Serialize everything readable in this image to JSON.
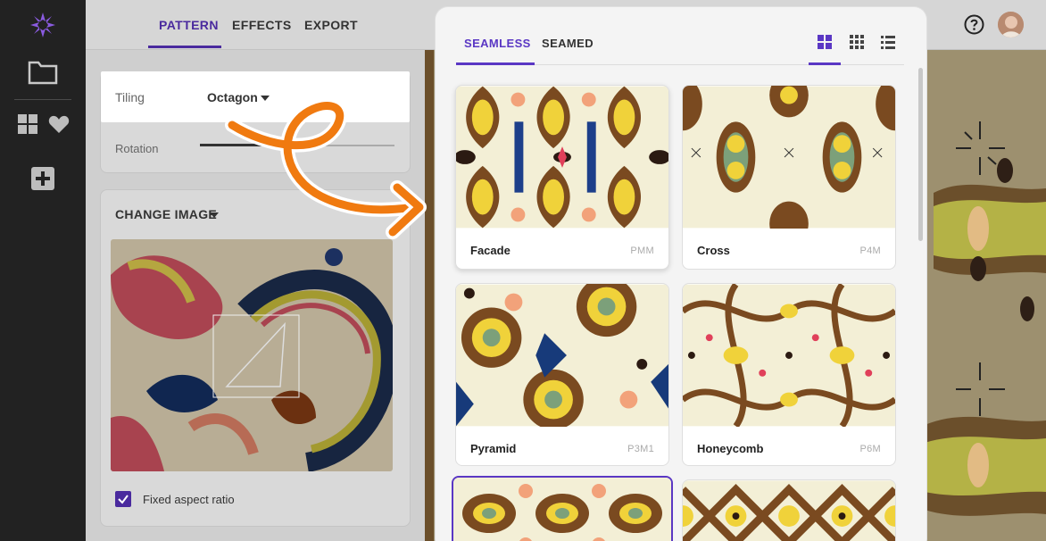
{
  "editor": {
    "tabs": [
      "PATTERN",
      "EFFECTS",
      "EXPORT"
    ],
    "tiling": {
      "label": "Tiling",
      "value": "Octagon"
    },
    "rotation": {
      "label": "Rotation"
    },
    "change_image": "CHANGE IMAGE",
    "aspect": {
      "label": "Fixed aspect ratio",
      "checked": true
    }
  },
  "modal": {
    "tabs": [
      "SEAMLESS",
      "SEAMED"
    ],
    "view_icons": [
      "large-grid-icon",
      "small-grid-icon",
      "list-icon"
    ],
    "tiles": [
      {
        "name": "Facade",
        "code": "PMM"
      },
      {
        "name": "Cross",
        "code": "P4M"
      },
      {
        "name": "Pyramid",
        "code": "P3M1"
      },
      {
        "name": "Honeycomb",
        "code": "P6M"
      },
      {
        "name": "",
        "code": ""
      },
      {
        "name": "",
        "code": ""
      }
    ]
  },
  "colors": {
    "accent": "#5a37c4",
    "rail": "#222222",
    "arrow": "#f07a10"
  }
}
